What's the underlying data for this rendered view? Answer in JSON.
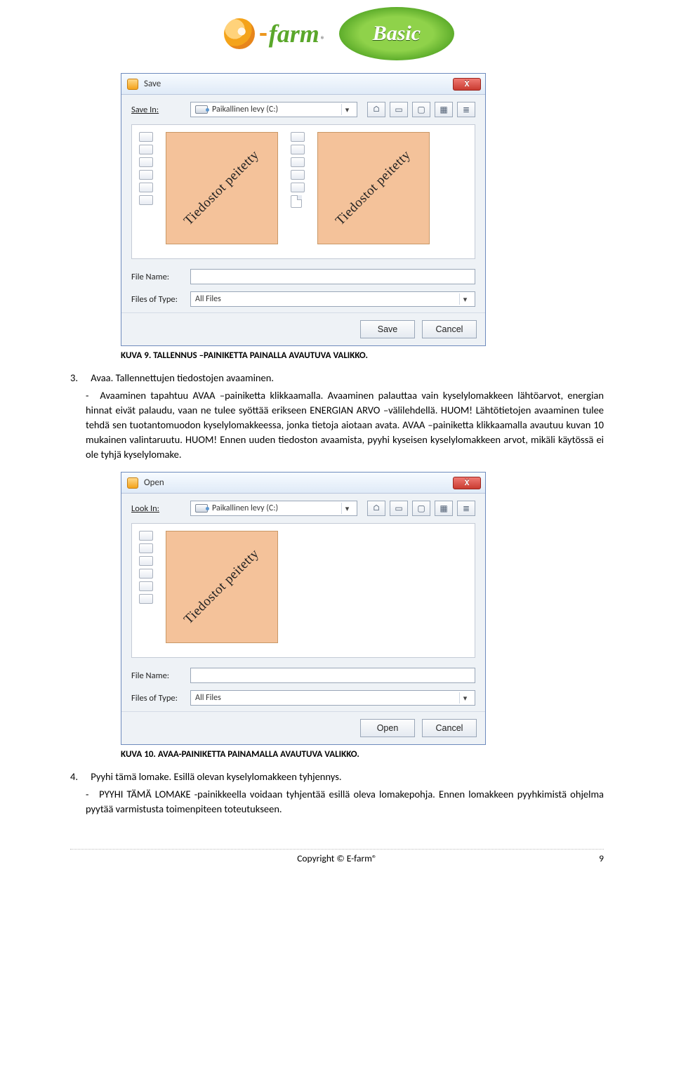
{
  "logos": {
    "efarm_dash": "-",
    "efarm_text": "farm",
    "efarm_reg": "®",
    "basic_text": "Basic"
  },
  "dialog_save": {
    "title": "Save",
    "close_glyph": "X",
    "location_label": "Save In:",
    "drive_label": "Paikallinen levy (C:)",
    "covered_text": "Tiedostot peitetty",
    "covered_text_2": "Tiedostot peitetty",
    "filename_label": "File Name:",
    "filename_value": "",
    "filter_label": "Files of Type:",
    "filter_value": "All Files",
    "btn_primary": "Save",
    "btn_cancel": "Cancel"
  },
  "caption_save": "KUVA 9. TALLENNUS –PAINIKETTA PAINALLA AVAUTUVA VALIKKO.",
  "step3_num": "3.",
  "step3_title": "Avaa. Tallennettujen tiedostojen avaaminen.",
  "step3_body": "Avaaminen tapahtuu AVAA –painiketta klikkaamalla. Avaaminen palauttaa vain kyselylomakkeen lähtöarvot, energian hinnat eivät palaudu, vaan ne tulee syöttää erikseen ENERGIAN ARVO –välilehdellä. HUOM! Lähtötietojen avaaminen tulee tehdä sen tuotantomuodon kyselylomakkeessa, jonka tietoja aiotaan avata. AVAA –painiketta klikkaamalla avautuu kuvan 10 mukainen valintaruutu. HUOM! Ennen uuden tiedoston avaamista, pyyhi kyseisen kyselylomakkeen arvot, mikäli käytössä ei ole tyhjä kyselylomake.",
  "dialog_open": {
    "title": "Open",
    "close_glyph": "X",
    "location_label": "Look In:",
    "drive_label": "Paikallinen levy (C:)",
    "covered_text": "Tiedostot peitetty",
    "filename_label": "File Name:",
    "filename_value": "",
    "filter_label": "Files of Type:",
    "filter_value": "All Files",
    "btn_primary": "Open",
    "btn_cancel": "Cancel"
  },
  "caption_open": "KUVA 10. AVAA-PAINIKETTA PAINAMALLA AVAUTUVA VALIKKO.",
  "step4_num": "4.",
  "step4_title": "Pyyhi tämä lomake. Esillä olevan kyselylomakkeen tyhjennys.",
  "step4_body": "PYYHI TÄMÄ LOMAKE -painikkeella voidaan tyhjentää esillä oleva lomakepohja. Ennen lomakkeen pyyhkimistä ohjelma pyytää varmistusta toimenpiteen toteutukseen.",
  "footer_text": "Copyright © E-farm®",
  "page_number": "9",
  "icons": {
    "drive": "drive-icon",
    "chevron_down": "▾",
    "home": "⌂",
    "up": "▭",
    "new": "▢",
    "grid": "▦",
    "list": "≣"
  }
}
